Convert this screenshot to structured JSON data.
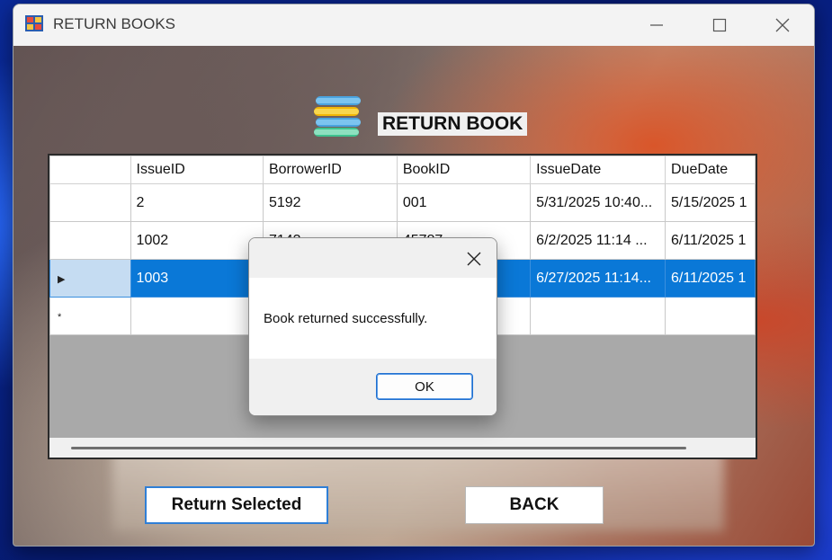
{
  "window": {
    "title": "RETURN BOOKS"
  },
  "header": {
    "title": "RETURN BOOK"
  },
  "grid": {
    "columns": [
      "IssueID",
      "BorrowerID",
      "BookID",
      "IssueDate",
      "DueDate"
    ],
    "rows": [
      {
        "cells": [
          "2",
          "5192",
          "001",
          "5/31/2025 10:40...",
          "5/15/2025 1"
        ],
        "selected": false
      },
      {
        "cells": [
          "1002",
          "7143",
          "45787",
          "6/2/2025 11:14 ...",
          "6/11/2025 1"
        ],
        "selected": false
      },
      {
        "cells": [
          "1003",
          "",
          "",
          "6/27/2025 11:14...",
          "6/11/2025 1"
        ],
        "selected": true
      }
    ],
    "new_row_marker": "*",
    "current_row_marker": "▶"
  },
  "buttons": {
    "return_label": "Return Selected",
    "back_label": "BACK"
  },
  "dialog": {
    "message": "Book returned successfully.",
    "ok_label": "OK"
  },
  "colors": {
    "selection": "#0a78d7",
    "selection_header": "#c5dcf2",
    "button_focus_border": "#2f7fd6"
  }
}
